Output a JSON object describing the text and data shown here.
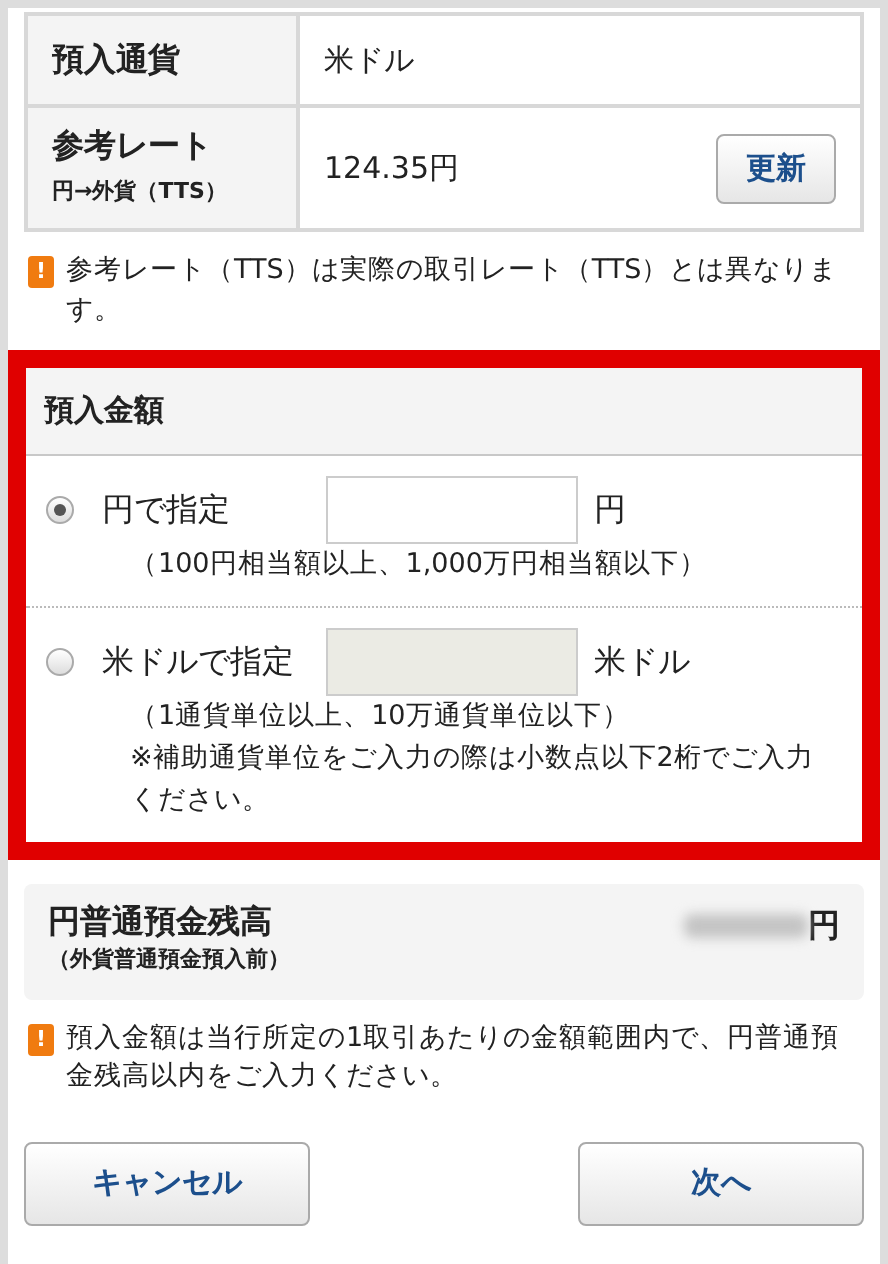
{
  "currency": {
    "label": "預入通貨",
    "value": "米ドル"
  },
  "rate": {
    "label": "参考レート",
    "sublabel": "円→外貨（TTS）",
    "value": "124.35円",
    "button": "更新"
  },
  "rate_note": {
    "icon": "!",
    "text": "参考レート（TTS）は実際の取引レート（TTS）とは異なります。"
  },
  "amount": {
    "title": "預入金額",
    "options": [
      {
        "label": "円で指定",
        "selected": true,
        "disabled": false,
        "unit": "円",
        "hints": [
          "（100円相当額以上、1,000万円相当額以下）"
        ]
      },
      {
        "label": "米ドルで指定",
        "selected": false,
        "disabled": true,
        "unit": "米ドル",
        "hints": [
          "（1通貨単位以上、10万通貨単位以下）",
          "※補助通貨単位をご入力の際は小数点以下2桁でご入力ください。"
        ]
      }
    ]
  },
  "balance": {
    "label": "円普通預金残高",
    "sublabel": "（外貨普通預金預入前）",
    "unit": "円"
  },
  "amount_note": {
    "icon": "!",
    "text": "預入金額は当行所定の1取引あたりの金額範囲内で、円普通預金残高以内をご入力ください。"
  },
  "buttons": [
    "キャンセル",
    "次へ"
  ]
}
